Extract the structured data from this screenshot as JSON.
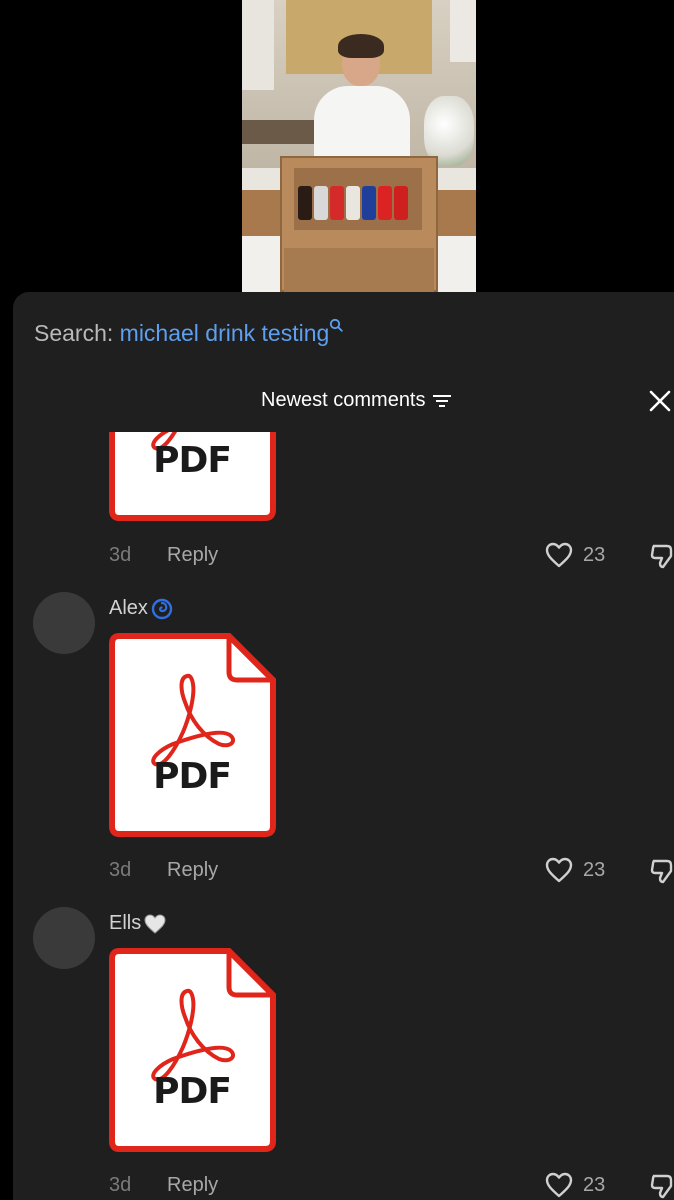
{
  "search": {
    "prefix": "Search:",
    "term": "michael drink testing"
  },
  "sort": {
    "label": "Newest comments"
  },
  "comments": [
    {
      "username": "",
      "attachment_label": "PDF",
      "age": "3d",
      "reply_label": "Reply",
      "likes": "23"
    },
    {
      "username": "Alex",
      "username_emoji": "cyclone-emoji",
      "attachment_label": "PDF",
      "age": "3d",
      "reply_label": "Reply",
      "likes": "23"
    },
    {
      "username": "Ells",
      "username_emoji": "white-heart-emoji",
      "attachment_label": "PDF",
      "age": "3d",
      "reply_label": "Reply",
      "likes": "23"
    }
  ],
  "colors": {
    "sheet_background": "#1f1f1f",
    "search_term": "#5e9ff0",
    "pdf_red": "#e0261b",
    "muted_text": "#a8a8a8"
  },
  "icons": {
    "search": "search-icon",
    "sort": "sort-filter-icon",
    "close": "close-icon",
    "like": "heart-outline-icon",
    "dislike": "thumbs-down-icon",
    "attachment": "pdf-file-icon"
  }
}
